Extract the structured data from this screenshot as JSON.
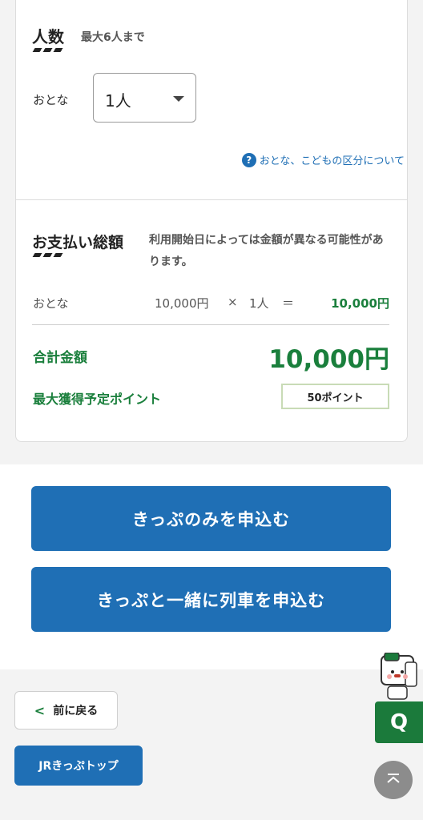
{
  "people": {
    "title": "人数",
    "subtitle": "最大6人まで",
    "adult_label": "おとな",
    "adult_value": "1人"
  },
  "help_link": "おとな、こどもの区分について",
  "payment": {
    "title": "お支払い総額",
    "note": "利用開始日によっては金額が異なる可能性があります。",
    "row_label": "おとな",
    "unit_price": "10,000円",
    "times": "×",
    "qty": "1人",
    "equals": "＝",
    "row_total": "10,000円",
    "total_label": "合計金額",
    "total_value": "10,000円",
    "points_label": "最大獲得予定ポイント",
    "points_value": "50ポイント"
  },
  "buttons": {
    "ticket_only": "きっぷのみを申込む",
    "ticket_with_train": "きっぷと一緒に列車を申込む",
    "back": "前に戻る",
    "top": "JRきっぷトップ",
    "q": "Q"
  },
  "colors": {
    "primary_blue": "#1f6fb5",
    "green": "#1a7f3c",
    "background": "#f3f3f3"
  }
}
